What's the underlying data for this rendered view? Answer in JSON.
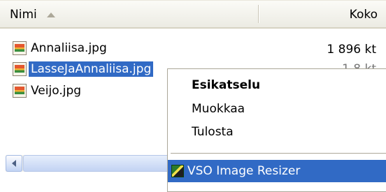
{
  "explorer": {
    "columns": {
      "name": "Nimi",
      "size": "Koko"
    },
    "files": [
      {
        "name": "Annaliisa.jpg",
        "size": "1 896 kt",
        "selected": false
      },
      {
        "name": "LasseJaAnnaliisa.jpg",
        "size": "1 8 kt",
        "selected": true
      },
      {
        "name": "Veijo.jpg",
        "size": "",
        "selected": false
      }
    ]
  },
  "context_menu": {
    "items": [
      {
        "label": "Esikatselu",
        "bold": true
      },
      {
        "label": "Muokkaa",
        "bold": false
      },
      {
        "label": "Tulosta",
        "bold": false
      }
    ],
    "highlighted_item": "VSO Image Resizer"
  },
  "icons": {
    "sort": "sort-ascending-icon",
    "file": "jpg-file-icon",
    "app": "vso-image-resizer-icon",
    "scroll_left": "scroll-left-arrow-icon"
  },
  "colors": {
    "selection": "#316ac5",
    "header_bg": "#ecebe3"
  }
}
